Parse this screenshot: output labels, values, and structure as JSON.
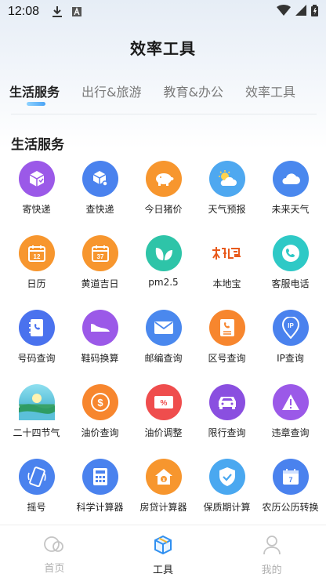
{
  "status": {
    "time": "12:08"
  },
  "header": {
    "title": "效率工具"
  },
  "tabs": [
    {
      "label": "生活服务",
      "active": true
    },
    {
      "label": "出行&旅游",
      "active": false
    },
    {
      "label": "教育&办公",
      "active": false
    },
    {
      "label": "效率工具",
      "active": false
    }
  ],
  "section": {
    "title": "生活服务"
  },
  "tools": [
    {
      "label": "寄快递",
      "icon": "package-send-icon",
      "color": "#9b59e8"
    },
    {
      "label": "查快递",
      "icon": "package-search-icon",
      "color": "#4a82ee"
    },
    {
      "label": "今日猪价",
      "icon": "pig-icon",
      "color": "#f7962e"
    },
    {
      "label": "天气预报",
      "icon": "sun-cloud-icon",
      "color": "#4ea8f0"
    },
    {
      "label": "未来天气",
      "icon": "cloud-icon",
      "color": "#4a88ee"
    },
    {
      "label": "日历",
      "icon": "calendar-icon",
      "color": "#f7962e"
    },
    {
      "label": "黄道吉日",
      "icon": "calendar-37-icon",
      "color": "#f7962e"
    },
    {
      "label": "pm2.5",
      "icon": "leaf-icon",
      "color": "#2ec4a8"
    },
    {
      "label": "本地宝",
      "icon": "bendibao-logo-icon",
      "color": "#ffffff"
    },
    {
      "label": "客服电话",
      "icon": "phone-icon",
      "color": "#2ec9c6"
    },
    {
      "label": "号码查询",
      "icon": "phone-book-icon",
      "color": "#4a72ee"
    },
    {
      "label": "鞋码换算",
      "icon": "shoe-icon",
      "color": "#9b59e8"
    },
    {
      "label": "邮编查询",
      "icon": "envelope-icon",
      "color": "#4a88ee"
    },
    {
      "label": "区号查询",
      "icon": "phone-card-icon",
      "color": "#f7862e"
    },
    {
      "label": "IP查询",
      "icon": "ip-location-icon",
      "color": "#4a82ee"
    },
    {
      "label": "二十四节气",
      "icon": "landscape-icon",
      "color": "#5bc0d9"
    },
    {
      "label": "油价查询",
      "icon": "dollar-coin-icon",
      "color": "#f7862e"
    },
    {
      "label": "油价调整",
      "icon": "percent-tag-icon",
      "color": "#ef4d4d"
    },
    {
      "label": "限行查询",
      "icon": "car-icon",
      "color": "#8a4fe0"
    },
    {
      "label": "违章查询",
      "icon": "warning-icon",
      "color": "#9b59e8"
    },
    {
      "label": "摇号",
      "icon": "phone-shake-icon",
      "color": "#4a82ee"
    },
    {
      "label": "科学计算器",
      "icon": "calculator-icon",
      "color": "#4a82ee"
    },
    {
      "label": "房贷计算器",
      "icon": "house-money-icon",
      "color": "#f7962e"
    },
    {
      "label": "保质期计算",
      "icon": "shield-check-icon",
      "color": "#4aa8f0"
    },
    {
      "label": "农历公历转换",
      "icon": "calendar-7-icon",
      "color": "#4a82ee"
    }
  ],
  "bottom_nav": [
    {
      "label": "首页",
      "icon": "home-icon",
      "active": false
    },
    {
      "label": "工具",
      "icon": "cube-icon",
      "active": true
    },
    {
      "label": "我的",
      "icon": "user-icon",
      "active": false
    }
  ],
  "colors": {
    "accent": "#4aa3f5",
    "text": "#222222",
    "inactive": "#b0b0b0"
  }
}
